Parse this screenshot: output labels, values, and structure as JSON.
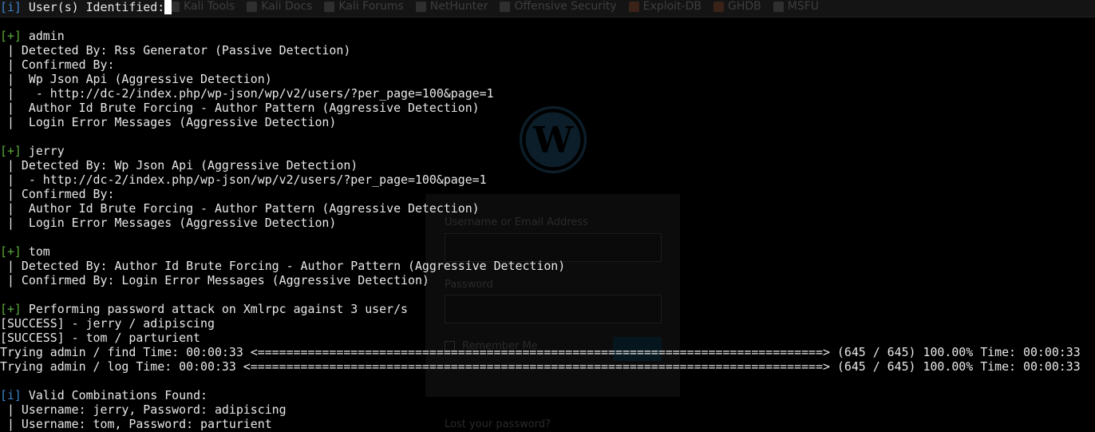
{
  "browser": {
    "bookmarks": [
      {
        "label": "Kali Tools",
        "icon": "kali-dragon-icon"
      },
      {
        "label": "Kali Docs",
        "icon": "kali-dragon-icon"
      },
      {
        "label": "Kali Forums",
        "icon": "kali-dragon-icon"
      },
      {
        "label": "NetHunter",
        "icon": "kali-dragon-icon"
      },
      {
        "label": "Offensive Security",
        "icon": "offsec-icon"
      },
      {
        "label": "Exploit-DB",
        "icon": "exploit-db-icon"
      },
      {
        "label": "GHDB",
        "icon": "ghdb-icon"
      },
      {
        "label": "MSFU",
        "icon": "msfu-icon"
      }
    ],
    "login": {
      "username_label": "Username or Email Address",
      "password_label": "Password",
      "remember_label": "Remember Me",
      "lost_password": "Lost your password?"
    }
  },
  "terminal": {
    "colors": {
      "info": "#3c82c8",
      "plus": "#5aaa3c",
      "text": "#e8e8e8",
      "background": "#000000"
    },
    "lines": [
      {
        "tag": "[i]",
        "tag_type": "info",
        "text": " User(s) Identified:",
        "highlight_last": true
      },
      {
        "tag": "",
        "text": ""
      },
      {
        "tag": "[+]",
        "tag_type": "plus",
        "text": " admin"
      },
      {
        "tag": "",
        "text": " | Detected By: Rss Generator (Passive Detection)"
      },
      {
        "tag": "",
        "text": " | Confirmed By:"
      },
      {
        "tag": "",
        "text": " |  Wp Json Api (Aggressive Detection)"
      },
      {
        "tag": "",
        "text": " |   - http://dc-2/index.php/wp-json/wp/v2/users/?per_page=100&page=1"
      },
      {
        "tag": "",
        "text": " |  Author Id Brute Forcing - Author Pattern (Aggressive Detection)"
      },
      {
        "tag": "",
        "text": " |  Login Error Messages (Aggressive Detection)"
      },
      {
        "tag": "",
        "text": ""
      },
      {
        "tag": "[+]",
        "tag_type": "plus",
        "text": " jerry"
      },
      {
        "tag": "",
        "text": " | Detected By: Wp Json Api (Aggressive Detection)"
      },
      {
        "tag": "",
        "text": " |  - http://dc-2/index.php/wp-json/wp/v2/users/?per_page=100&page=1"
      },
      {
        "tag": "",
        "text": " | Confirmed By:"
      },
      {
        "tag": "",
        "text": " |  Author Id Brute Forcing - Author Pattern (Aggressive Detection)"
      },
      {
        "tag": "",
        "text": " |  Login Error Messages (Aggressive Detection)"
      },
      {
        "tag": "",
        "text": ""
      },
      {
        "tag": "[+]",
        "tag_type": "plus",
        "text": " tom"
      },
      {
        "tag": "",
        "text": " | Detected By: Author Id Brute Forcing - Author Pattern (Aggressive Detection)"
      },
      {
        "tag": "",
        "text": " | Confirmed By: Login Error Messages (Aggressive Detection)"
      },
      {
        "tag": "",
        "text": ""
      },
      {
        "tag": "[+]",
        "tag_type": "plus",
        "text": " Performing password attack on Xmlrpc against 3 user/s"
      },
      {
        "tag": "",
        "text": "[SUCCESS] - jerry / adipiscing"
      },
      {
        "tag": "",
        "text": "[SUCCESS] - tom / parturient"
      },
      {
        "tag": "",
        "text": "Trying admin / find Time: 00:00:33 <===============================================================================> (645 / 645) 100.00% Time: 00:00:33"
      },
      {
        "tag": "",
        "text": "Trying admin / log Time: 00:00:33 <================================================================================> (645 / 645) 100.00% Time: 00:00:33"
      },
      {
        "tag": "",
        "text": ""
      },
      {
        "tag": "[i]",
        "tag_type": "info",
        "text": " Valid Combinations Found:"
      },
      {
        "tag": "",
        "text": " | Username: jerry, Password: adipiscing"
      },
      {
        "tag": "",
        "text": " | Username: tom, Password: parturient"
      }
    ]
  }
}
